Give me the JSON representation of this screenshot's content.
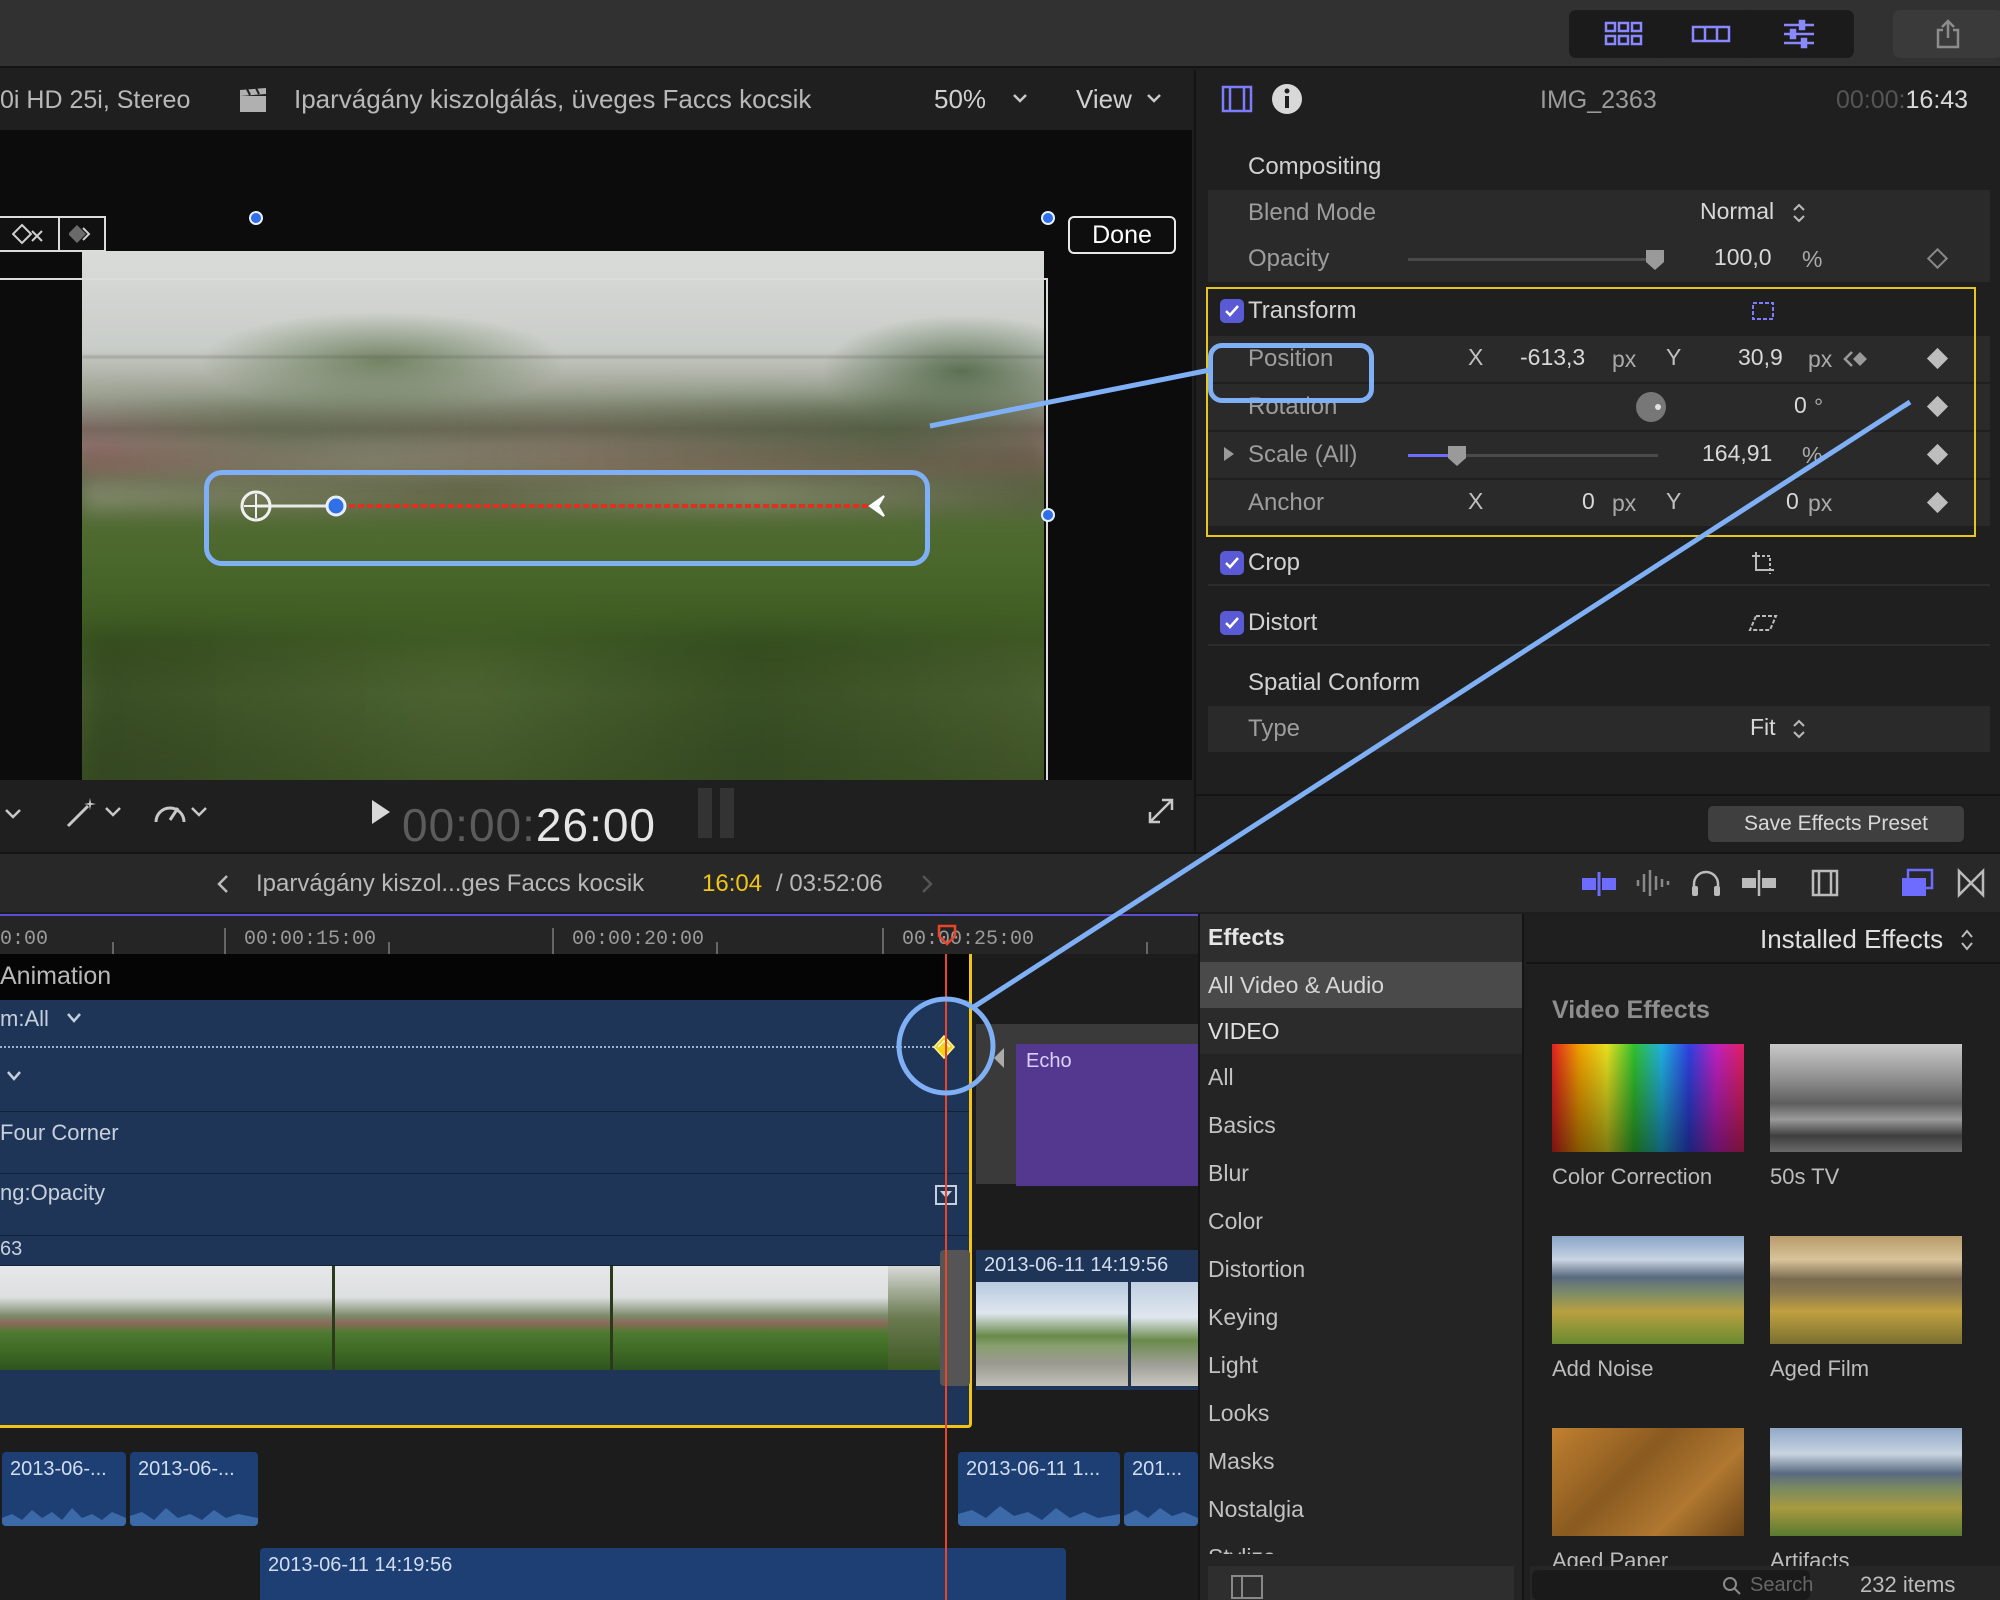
{
  "toolbar": {
    "buttons": [
      "grid-view-icon",
      "filmstrip-view-icon",
      "inspector-sliders-icon",
      "share-icon"
    ]
  },
  "viewer": {
    "format": "0i HD 25i, Stereo",
    "clip_title": "Iparvágány kiszolgálás, üveges Faccs kocsik",
    "zoom": "50%",
    "view_label": "View",
    "done_label": "Done",
    "timecode_dim": "00:00:",
    "timecode_bright": "26:00"
  },
  "inspector": {
    "clip_name": "IMG_2363",
    "duration_dim": "00:00:",
    "duration_bright": "16:43",
    "compositing": {
      "title": "Compositing",
      "blend_mode_label": "Blend Mode",
      "blend_mode_value": "Normal",
      "opacity_label": "Opacity",
      "opacity_value": "100,0",
      "opacity_unit": "%",
      "opacity_level": 1.0
    },
    "transform": {
      "title": "Transform",
      "position_label": "Position",
      "x_label": "X",
      "position_x": "-613,3",
      "y_label": "Y",
      "position_y": "30,9",
      "px": "px",
      "rotation_label": "Rotation",
      "rotation_value": "0",
      "rotation_unit": "°",
      "scale_label": "Scale (All)",
      "scale_value": "164,91",
      "scale_unit": "%",
      "anchor_label": "Anchor",
      "anchor_x": "0",
      "anchor_y": "0"
    },
    "crop_title": "Crop",
    "distort_title": "Distort",
    "spatial_conform": {
      "title": "Spatial Conform",
      "type_label": "Type",
      "type_value": "Fit"
    },
    "save_preset_label": "Save Effects Preset"
  },
  "timeline": {
    "project_name": "Iparvágány kiszol...ges Faccs kocsik",
    "current_time": "16:04",
    "total_time": "/ 03:52:06",
    "ruler": [
      "0:00",
      "00:00:15:00",
      "00:00:20:00",
      "00:00:25:00"
    ],
    "lanes": {
      "animation": "Animation",
      "transform_all": "m:All",
      "four_corner": "Four Corner",
      "opacity": "ng:Opacity",
      "clip_id": "63"
    },
    "echo_clip": "Echo",
    "video_clip_right": "2013-06-11 14:19:56",
    "audio_clips": [
      "2013-06-...",
      "2013-06-...",
      "2013-06-11 1...",
      "201..."
    ],
    "lower_clip": "2013-06-11 14:19:56"
  },
  "effects": {
    "header": "Effects",
    "filter": "Installed Effects",
    "categories": [
      "All Video & Audio",
      "VIDEO",
      "All",
      "Basics",
      "Blur",
      "Color",
      "Distortion",
      "Keying",
      "Light",
      "Looks",
      "Masks",
      "Nostalgia",
      "Stylize"
    ],
    "section_title": "Video Effects",
    "items": [
      "Color Correction",
      "50s TV",
      "Add Noise",
      "Aged Film",
      "Aged Paper",
      "Artifacts"
    ],
    "search_placeholder": "Search",
    "count": "232 items"
  },
  "colors": {
    "accent_blue": "#7fb0f5",
    "selection_yellow": "#e6c51c",
    "playhead": "#e8462a",
    "clip_blue": "#1f3557",
    "echo_purple": "#54388f"
  }
}
